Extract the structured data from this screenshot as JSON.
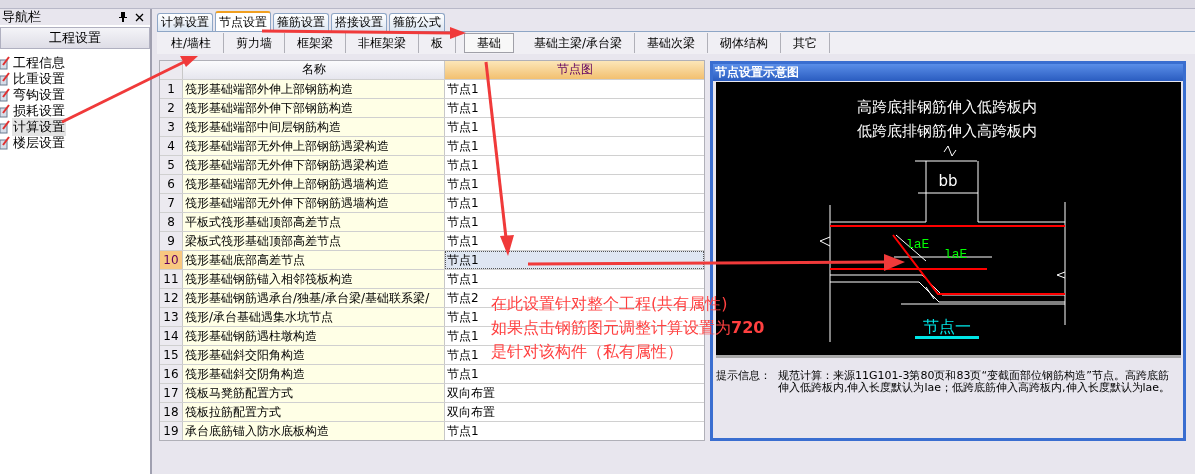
{
  "nav": {
    "title": "导航栏",
    "section": "工程设置",
    "items": [
      {
        "label": "工程信息",
        "selected": false
      },
      {
        "label": "比重设置",
        "selected": false
      },
      {
        "label": "弯钩设置",
        "selected": false
      },
      {
        "label": "损耗设置",
        "selected": false
      },
      {
        "label": "计算设置",
        "selected": true
      },
      {
        "label": "楼层设置",
        "selected": false
      }
    ]
  },
  "tabs": [
    {
      "label": "计算设置",
      "selected": false
    },
    {
      "label": "节点设置",
      "selected": true
    },
    {
      "label": "箍筋设置",
      "selected": false
    },
    {
      "label": "搭接设置",
      "selected": false
    },
    {
      "label": "箍筋公式",
      "selected": false
    }
  ],
  "subtabs": [
    {
      "label": "柱/墙柱",
      "selected": false
    },
    {
      "label": "剪力墙",
      "selected": false
    },
    {
      "label": "框架梁",
      "selected": false
    },
    {
      "label": "非框架梁",
      "selected": false
    },
    {
      "label": "板",
      "selected": false
    },
    {
      "label": "基础",
      "selected": true
    },
    {
      "label": "基础主梁/承台梁",
      "selected": false
    },
    {
      "label": "基础次梁",
      "selected": false
    },
    {
      "label": "砌体结构",
      "selected": false
    },
    {
      "label": "其它",
      "selected": false
    }
  ],
  "table": {
    "columns": [
      "名称",
      "节点图"
    ],
    "rows": [
      {
        "num": "1",
        "name": "筏形基础端部外伸上部钢筋构造",
        "value": "节点1",
        "selected": false
      },
      {
        "num": "2",
        "name": "筏形基础端部外伸下部钢筋构造",
        "value": "节点1",
        "selected": false
      },
      {
        "num": "3",
        "name": "筏形基础端部中间层钢筋构造",
        "value": "节点1",
        "selected": false
      },
      {
        "num": "4",
        "name": "筏形基础端部无外伸上部钢筋遇梁构造",
        "value": "节点1",
        "selected": false
      },
      {
        "num": "5",
        "name": "筏形基础端部无外伸下部钢筋遇梁构造",
        "value": "节点1",
        "selected": false
      },
      {
        "num": "6",
        "name": "筏形基础端部无外伸上部钢筋遇墙构造",
        "value": "节点1",
        "selected": false
      },
      {
        "num": "7",
        "name": "筏形基础端部无外伸下部钢筋遇墙构造",
        "value": "节点1",
        "selected": false
      },
      {
        "num": "8",
        "name": "平板式筏形基础顶部高差节点",
        "value": "节点1",
        "selected": false
      },
      {
        "num": "9",
        "name": "梁板式筏形基础顶部高差节点",
        "value": "节点1",
        "selected": false
      },
      {
        "num": "10",
        "name": "筏形基础底部高差节点",
        "value": "节点1",
        "selected": true
      },
      {
        "num": "11",
        "name": "筏形基础钢筋锚入相邻筏板构造",
        "value": "节点1",
        "selected": false
      },
      {
        "num": "12",
        "name": "筏形基础钢筋遇承台/独基/承台梁/基础联系梁/",
        "value": "节点2",
        "selected": false
      },
      {
        "num": "13",
        "name": "筏形/承台基础遇集水坑节点",
        "value": "节点1",
        "selected": false
      },
      {
        "num": "14",
        "name": "筏形基础钢筋遇柱墩构造",
        "value": "节点1",
        "selected": false
      },
      {
        "num": "15",
        "name": "筏形基础斜交阳角构造",
        "value": "节点1",
        "selected": false
      },
      {
        "num": "16",
        "name": "筏形基础斜交阴角构造",
        "value": "节点1",
        "selected": false
      },
      {
        "num": "17",
        "name": "筏板马凳筋配置方式",
        "value": "双向布置",
        "selected": false
      },
      {
        "num": "18",
        "name": "筏板拉筋配置方式",
        "value": "双向布置",
        "selected": false
      },
      {
        "num": "19",
        "name": "承台底筋锚入防水底板构造",
        "value": "节点1",
        "selected": false
      }
    ]
  },
  "panel": {
    "title": "节点设置示意图",
    "heading": [
      "高跨底排钢筋伸入低跨板内",
      "低跨底排钢筋伸入高跨板内"
    ],
    "width_label": "bb",
    "anchor_labels": [
      "laE",
      "laE"
    ],
    "caption": "节点一",
    "hint_label": "提示信息：",
    "hint": "规范计算：来源11G101-3第80页和83页“变截面部位钢筋构造”节点。高跨底筋伸入低跨板内,伸入长度默认为lae；低跨底筋伸入高跨板内,伸入长度默认为lae。"
  },
  "annotation": [
    "在此设置针对整个工程(共有属性)",
    "如果点击钢筋图元调整计算设置为**720**",
    "是针对该构件（私有属性）"
  ]
}
